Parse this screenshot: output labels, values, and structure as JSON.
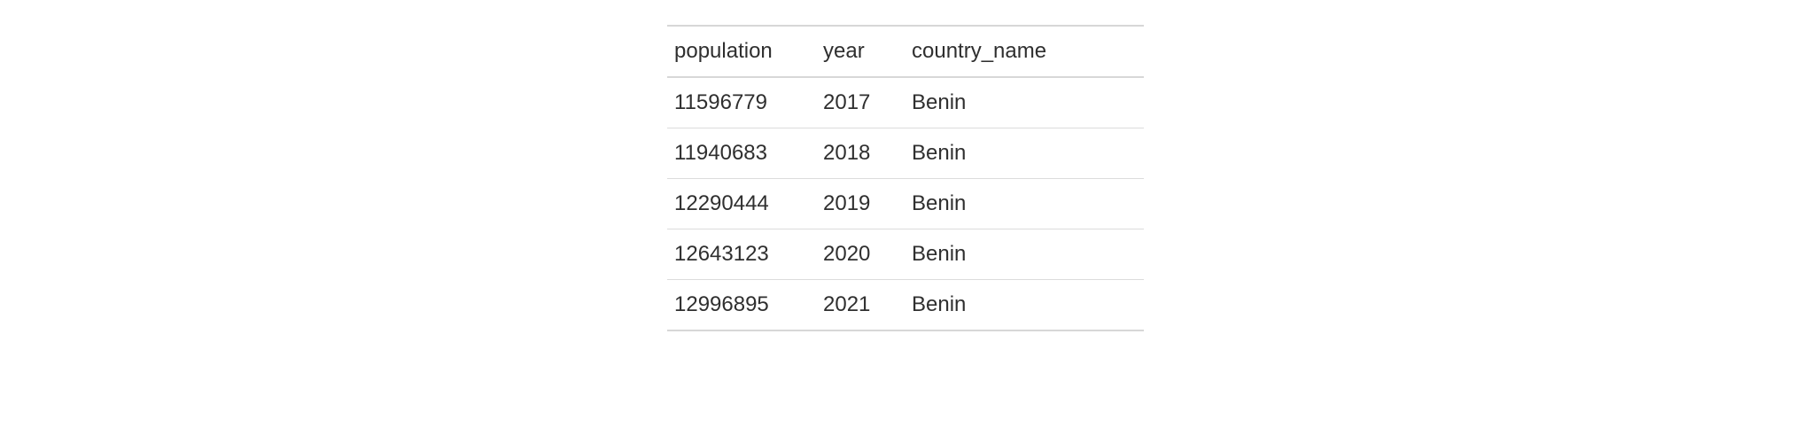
{
  "table": {
    "columns": [
      {
        "key": "population",
        "label": "population"
      },
      {
        "key": "year",
        "label": "year"
      },
      {
        "key": "country_name",
        "label": "country_name"
      }
    ],
    "rows": [
      {
        "population": "11596779",
        "year": "2017",
        "country_name": "Benin"
      },
      {
        "population": "11940683",
        "year": "2018",
        "country_name": "Benin"
      },
      {
        "population": "12290444",
        "year": "2019",
        "country_name": "Benin"
      },
      {
        "population": "12643123",
        "year": "2020",
        "country_name": "Benin"
      },
      {
        "population": "12996895",
        "year": "2021",
        "country_name": "Benin"
      }
    ]
  }
}
